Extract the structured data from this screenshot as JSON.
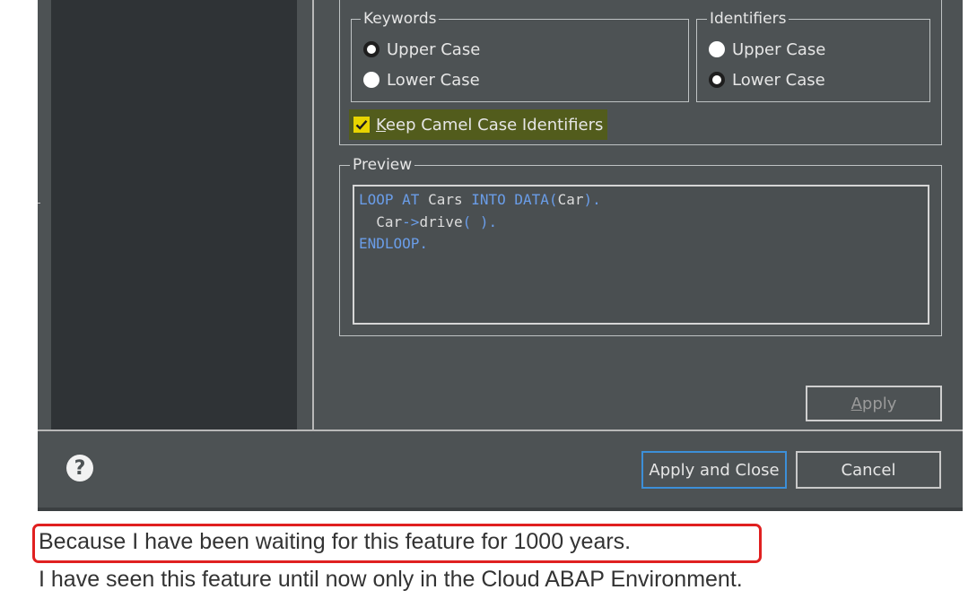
{
  "keywords": {
    "legend": "Keywords",
    "options": [
      {
        "label": "Upper Case",
        "selected": true
      },
      {
        "label": "Lower Case",
        "selected": false
      }
    ]
  },
  "identifiers": {
    "legend": "Identifiers",
    "options": [
      {
        "label": "Upper Case",
        "selected": false
      },
      {
        "label": "Lower Case",
        "selected": true
      }
    ]
  },
  "camel_case": {
    "mnemonic": "K",
    "rest": "eep Camel Case Identifiers",
    "checked": true
  },
  "preview": {
    "legend": "Preview",
    "line1": {
      "kw1": "LOOP AT ",
      "t1": "Cars ",
      "kw2": "INTO DATA(",
      "t2": "Car",
      "kw3": ")."
    },
    "line2": {
      "t1": "  Car",
      "kw1": "->",
      "t2": "drive",
      "kw2": "( )."
    },
    "line3": {
      "kw1": "ENDLOOP."
    }
  },
  "buttons": {
    "apply_mnemonic": "A",
    "apply_rest": "pply",
    "apply_and_close": "Apply and Close",
    "cancel": "Cancel"
  },
  "icons": {
    "help": "question-mark-circle-icon",
    "checkmark": "checkmark-icon"
  },
  "comment": {
    "line1": "Because I have been waiting for this feature for 1000 years.",
    "line2": "I have seen this feature until now only in the Cloud ABAP Environment."
  },
  "colors": {
    "dialog_bg": "#4d5254",
    "keyword_blue": "#6a9de8",
    "highlight_yellow": "#525c1c",
    "annotation_red": "#e02020"
  }
}
